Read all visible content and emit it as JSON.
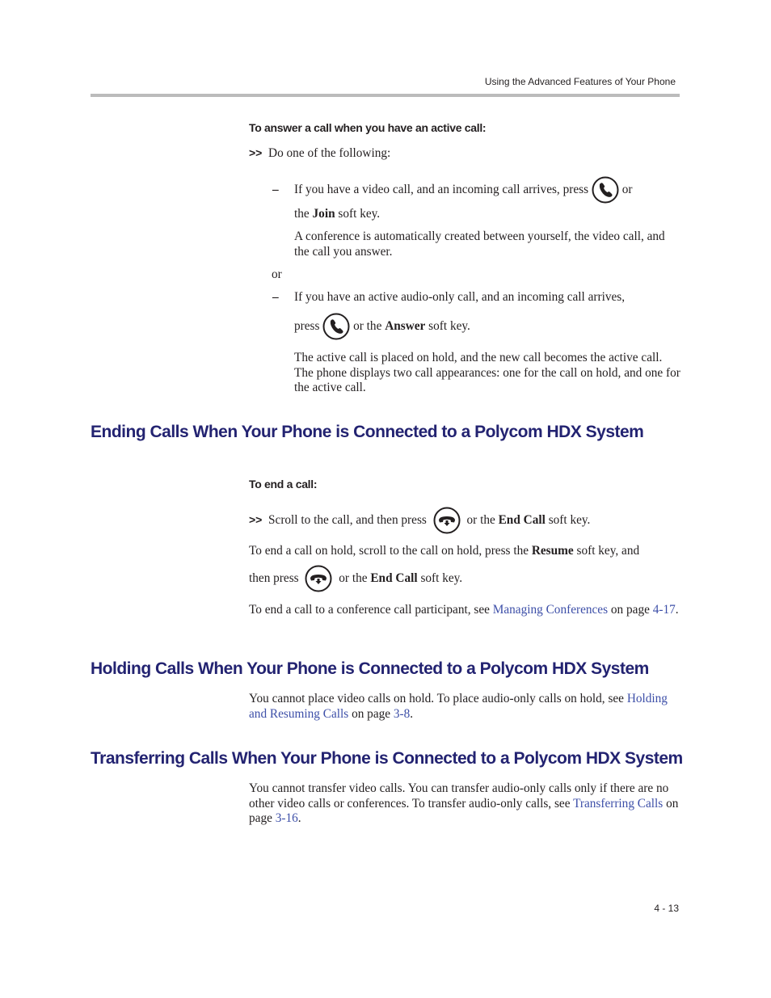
{
  "header": {
    "running_head": "Using the Advanced Features of Your Phone"
  },
  "answer_section": {
    "procedure_heading": "To answer a call when you have an active call:",
    "step_marker": ">>",
    "step_text": "Do one of the following:",
    "dash": "–",
    "option1": {
      "text_before_icon": "If you have a video call, and an incoming call arrives, press",
      "icon": "answer-call-icon",
      "text_after_icon": "or",
      "line2_prefix": "the",
      "softkey": "Join",
      "line2_suffix": "soft key.",
      "note": "A conference is automatically created between yourself, the video call, and the call you answer."
    },
    "or_label": "or",
    "option2": {
      "line1": "If you have an active audio-only call, and an incoming call arrives,",
      "press": "press",
      "icon": "answer-call-icon",
      "text_after_icon": "or the",
      "softkey": "Answer",
      "suffix": "soft key.",
      "note": "The active call is placed on hold, and the new call becomes the active call. The phone displays two call appearances: one for the call on hold, and one for the active call."
    }
  },
  "ending_section": {
    "title": "Ending Calls When Your Phone is Connected to a Polycom HDX System",
    "procedure_heading": "To end a call:",
    "step_marker": ">>",
    "step_text_before": "Scroll to the call, and then press",
    "icon": "end-call-icon",
    "step_text_after": "or the",
    "softkey": "End Call",
    "step_suffix": "soft key.",
    "hold_para_1": "To end a call on hold, scroll to the call on hold, press the",
    "hold_softkey": "Resume",
    "hold_para_2": "soft key, and",
    "hold_line2_prefix": "then press",
    "hold_line2_after": "or the",
    "hold_line2_softkey": "End Call",
    "hold_line2_suffix": "soft key.",
    "conf_text": "To end a call to a conference call participant, see",
    "conf_link": "Managing Conferences",
    "conf_on": "on",
    "conf_page_label": "page",
    "conf_page_link": "4-17",
    "period": "."
  },
  "holding_section": {
    "title": "Holding Calls When Your Phone is Connected to a Polycom HDX System",
    "text": "You cannot place video calls on hold. To place audio-only calls on hold, see",
    "link": "Holding and Resuming Calls",
    "on_page": "on page",
    "page_link": "3-8",
    "period": "."
  },
  "transferring_section": {
    "title": "Transferring Calls When Your Phone is Connected to a Polycom HDX System",
    "text": "You cannot transfer video calls. You can transfer audio-only calls only if there are no other video calls or conferences. To transfer audio-only calls, see",
    "link": "Transferring Calls",
    "on_page": "on page",
    "page_link": "3-16",
    "period": "."
  },
  "footer": {
    "page_number": "4 - 13"
  },
  "colors": {
    "heading": "#232371",
    "link": "#3d4fa8",
    "rule": "#bbbbbb"
  }
}
